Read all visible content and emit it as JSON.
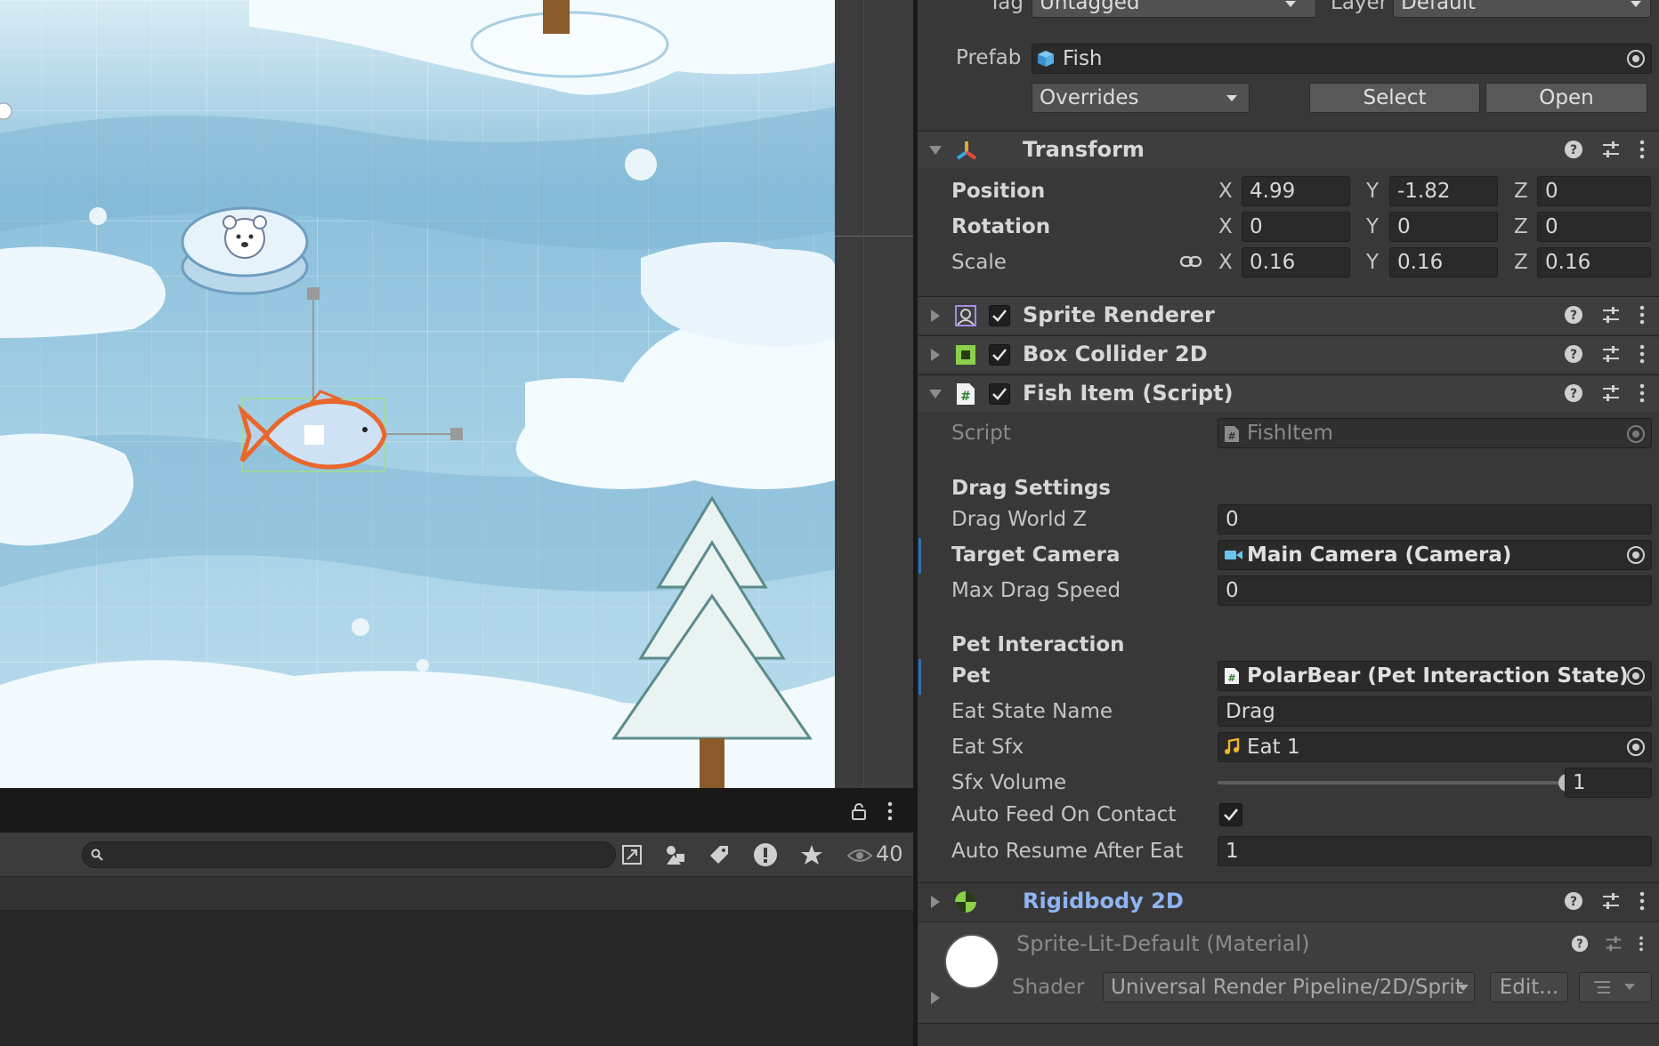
{
  "header": {
    "tag_label": "Tag",
    "tag_value": "Untagged",
    "layer_label": "Layer",
    "layer_value": "Default",
    "prefab_label": "Prefab",
    "prefab_value": "Fish",
    "overrides_label": "Overrides",
    "select_label": "Select",
    "open_label": "Open"
  },
  "transform": {
    "title": "Transform",
    "position_label": "Position",
    "rotation_label": "Rotation",
    "scale_label": "Scale",
    "axis_x": "X",
    "axis_y": "Y",
    "axis_z": "Z",
    "position": {
      "x": "4.99",
      "y": "-1.82",
      "z": "0"
    },
    "rotation": {
      "x": "0",
      "y": "0",
      "z": "0"
    },
    "scale": {
      "x": "0.16",
      "y": "0.16",
      "z": "0.16"
    }
  },
  "components": {
    "sprite_renderer": "Sprite Renderer",
    "box_collider": "Box Collider 2D",
    "fish_item": "Fish Item (Script)",
    "rigidbody": "Rigidbody 2D"
  },
  "fish_item": {
    "script_label": "Script",
    "script_value": "FishItem",
    "drag_settings_header": "Drag Settings",
    "drag_world_z_label": "Drag World Z",
    "drag_world_z_value": "0",
    "target_camera_label": "Target Camera",
    "target_camera_value": "Main Camera (Camera)",
    "max_drag_speed_label": "Max Drag Speed",
    "max_drag_speed_value": "0",
    "pet_interaction_header": "Pet Interaction",
    "pet_label": "Pet",
    "pet_value": "PolarBear (Pet Interaction State)",
    "eat_state_name_label": "Eat State Name",
    "eat_state_name_value": "Drag",
    "eat_sfx_label": "Eat Sfx",
    "eat_sfx_value": "Eat 1",
    "sfx_volume_label": "Sfx Volume",
    "sfx_volume_value": "1",
    "sfx_volume_fraction": 1.0,
    "auto_feed_label": "Auto Feed On Contact",
    "auto_feed_checked": true,
    "auto_resume_label": "Auto Resume After Eat",
    "auto_resume_value": "1"
  },
  "material": {
    "name": "Sprite-Lit-Default (Material)",
    "shader_label": "Shader",
    "shader_value": "Universal Render Pipeline/2D/Sprit",
    "edit_label": "Edit..."
  },
  "project": {
    "search_value": "",
    "visible_count": "40"
  },
  "colors": {
    "accent_blue": "#2f6fb6",
    "rigidbody_title": "#8fb4f2"
  }
}
